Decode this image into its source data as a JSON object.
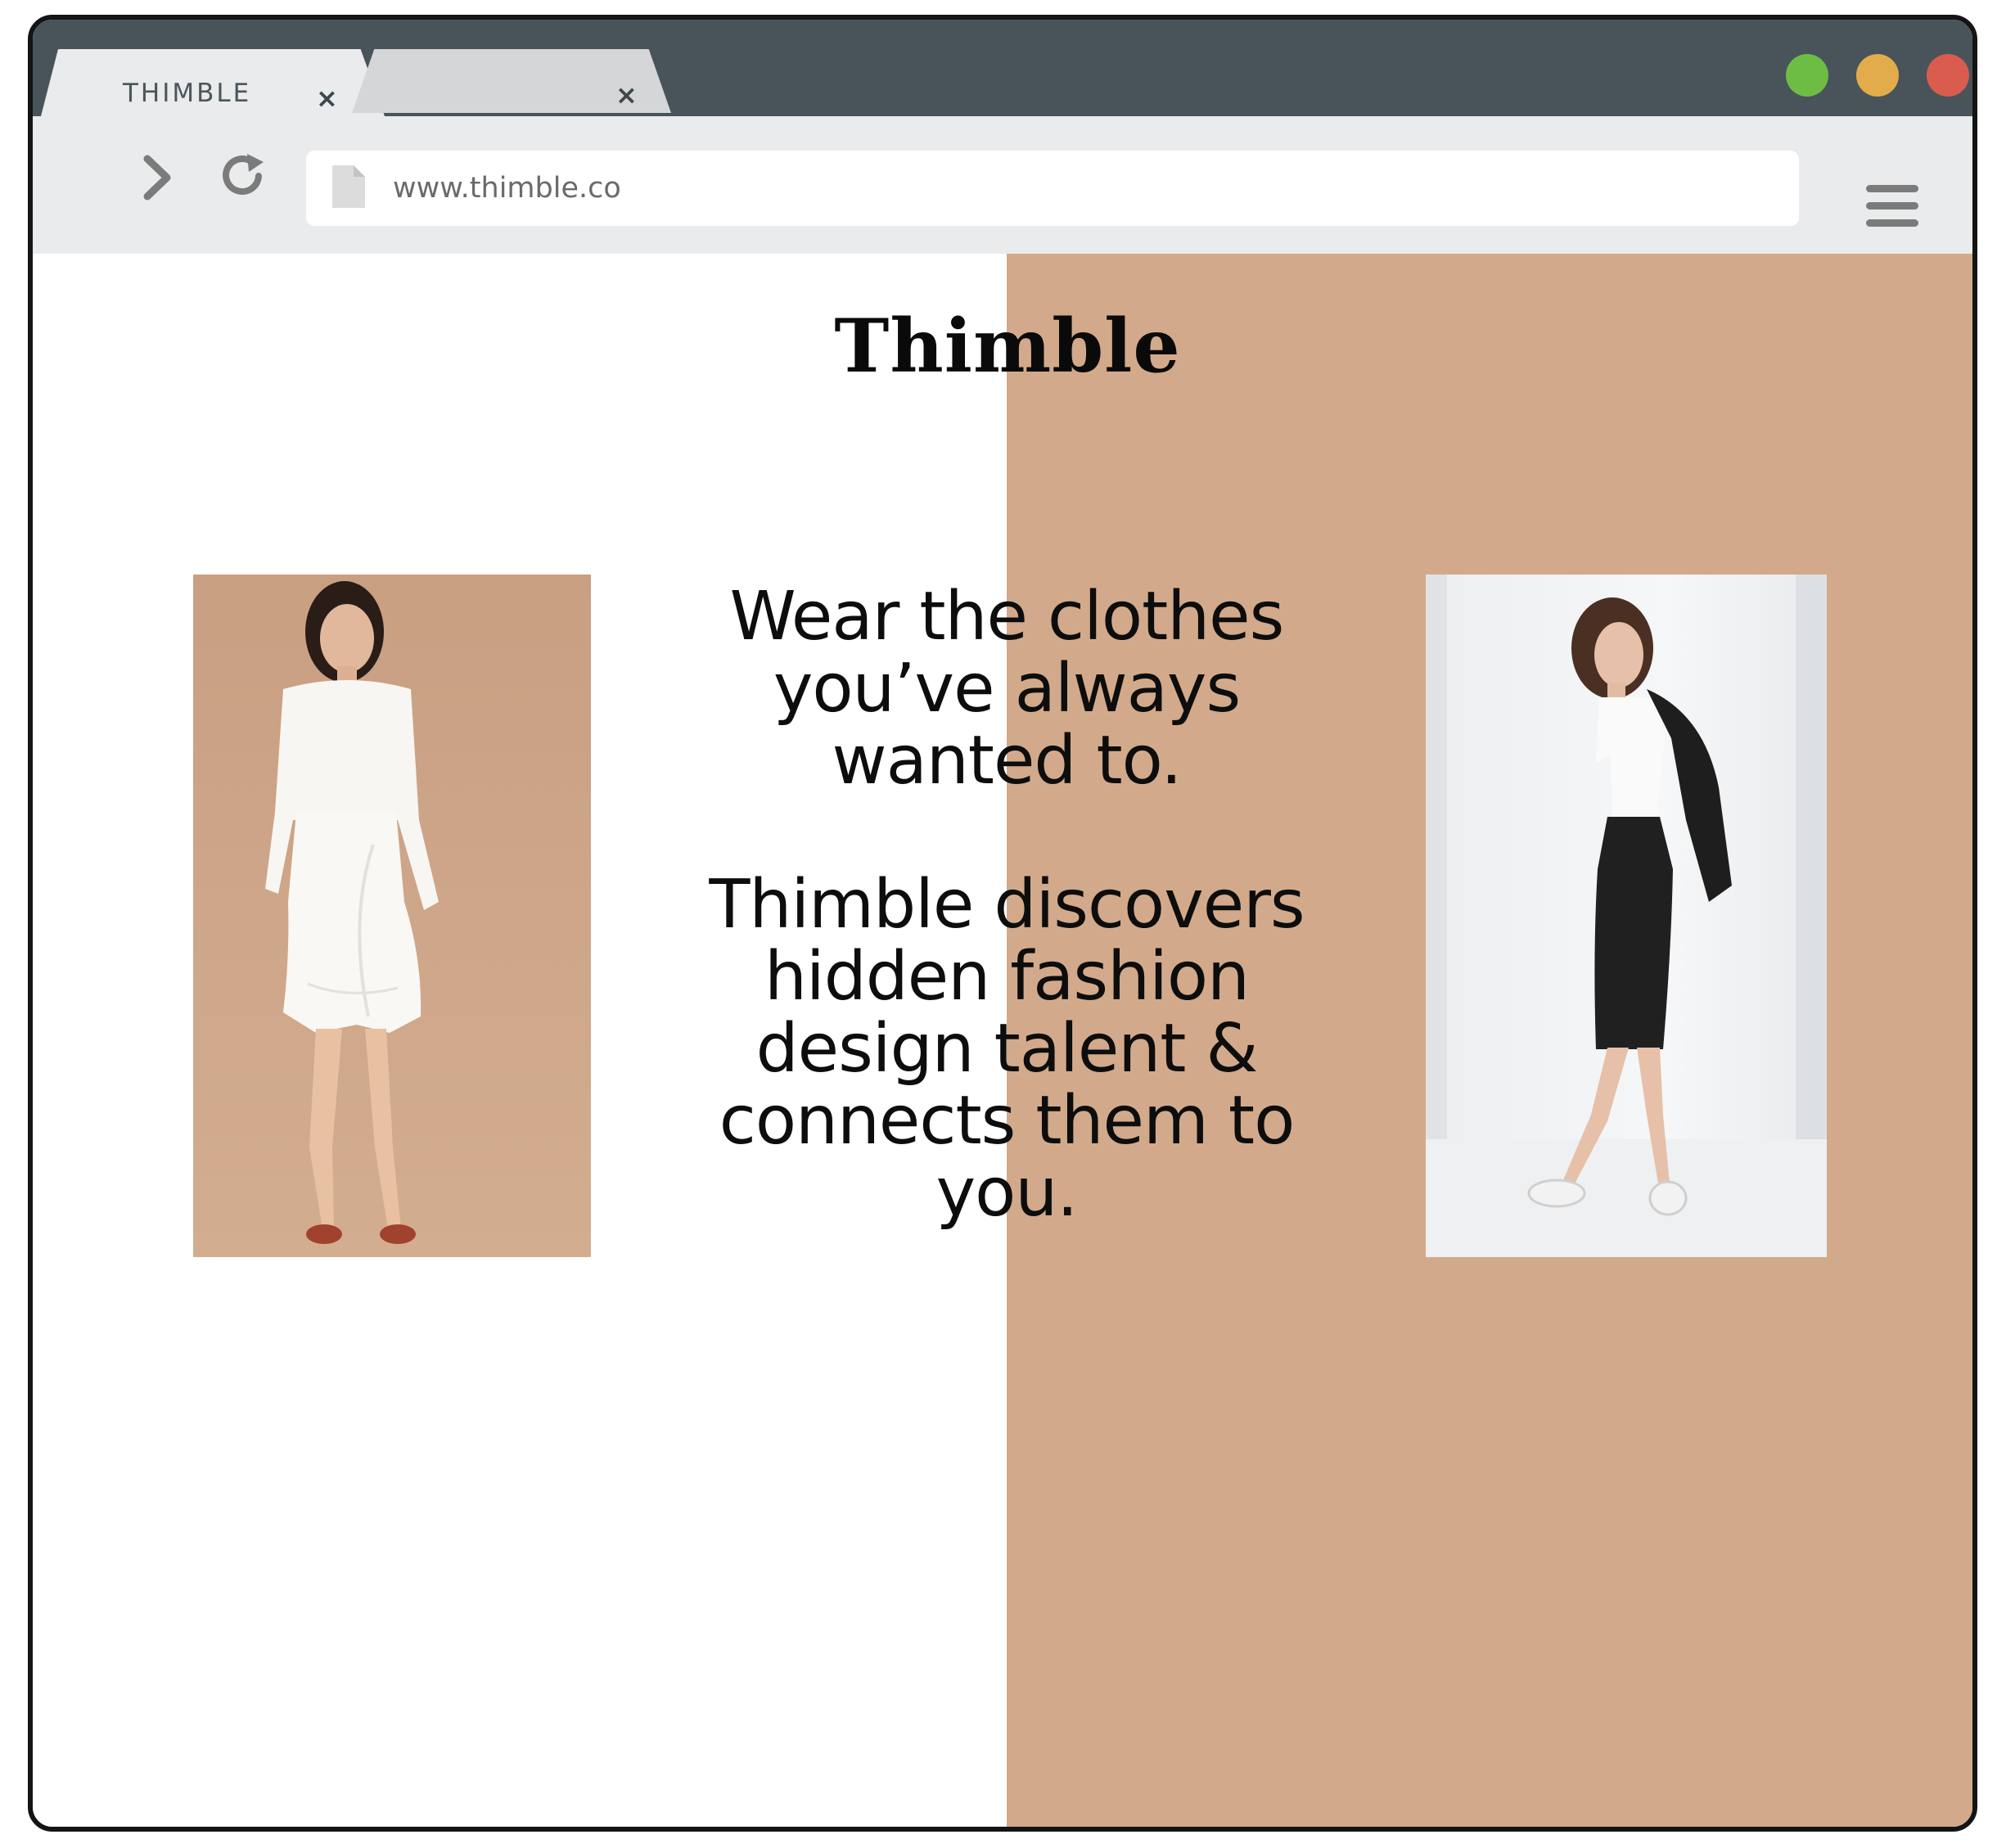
{
  "browser": {
    "tabs": [
      {
        "label": "THIMBLE",
        "close": "×",
        "active": true
      },
      {
        "label": "",
        "close": "×",
        "active": false
      }
    ],
    "window_controls": {
      "green": "#6dbd45",
      "yellow": "#e3ac4a",
      "red": "#d95c4e"
    },
    "address": {
      "url": "www.thimble.co",
      "icon": "page-icon"
    },
    "nav": {
      "forward_icon": "chevron-right-icon",
      "reload_icon": "reload-icon",
      "menu_icon": "hamburger-menu-icon"
    }
  },
  "page": {
    "brand": "Thimble",
    "tagline": "Wear the clothes you’ve always wanted to.",
    "description": "Thimble discovers hidden fashion design talent & connects them to you.",
    "accent_color": "#d2aa8b",
    "images": [
      {
        "name": "model-white-outfit-photo"
      },
      {
        "name": "model-black-skirt-photo"
      }
    ]
  }
}
